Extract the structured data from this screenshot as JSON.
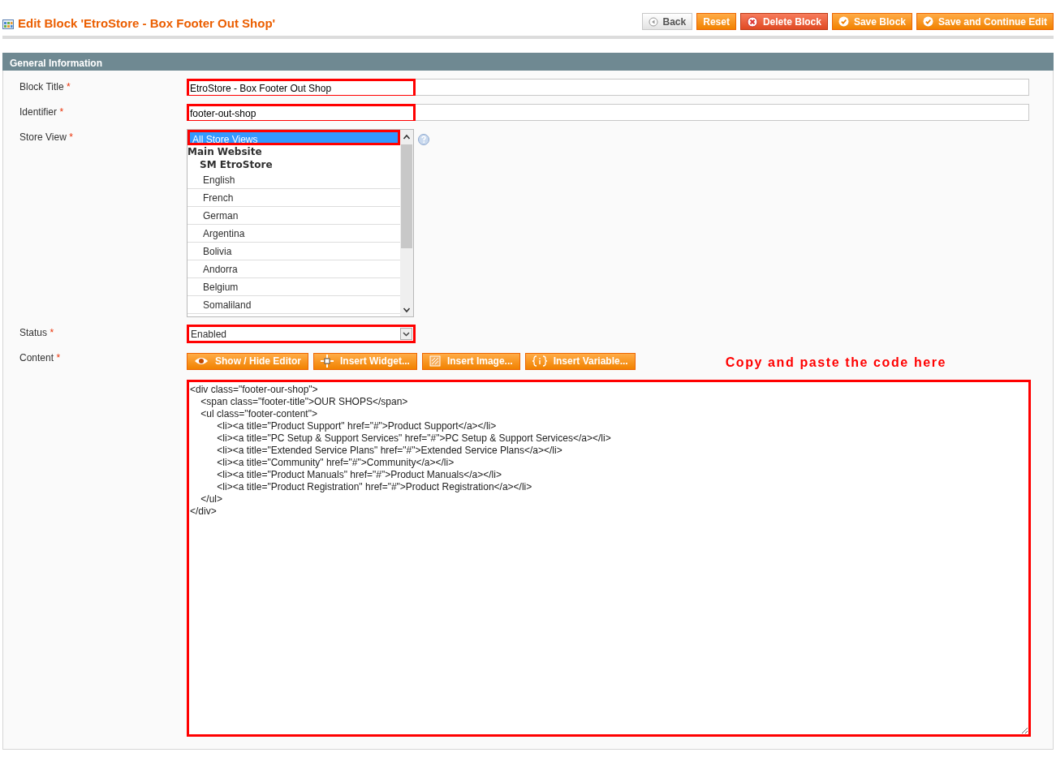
{
  "page": {
    "title": "Edit Block 'EtroStore - Box Footer Out Shop'"
  },
  "actions": [
    {
      "label": "Back",
      "kind": "back"
    },
    {
      "label": "Reset",
      "kind": "reset"
    },
    {
      "label": "Delete Block",
      "kind": "delete"
    },
    {
      "label": "Save Block",
      "kind": "save"
    },
    {
      "label": "Save and Continue Edit",
      "kind": "save"
    }
  ],
  "section": {
    "title": "General Information"
  },
  "fields": [
    {
      "kind": "text",
      "label": "Block Title",
      "required_mark": "*",
      "value": "EtroStore - Box Footer Out Shop",
      "highlighted": true
    },
    {
      "kind": "text",
      "label": "Identifier",
      "required_mark": "*",
      "value": "footer-out-shop",
      "highlighted": true
    },
    {
      "kind": "multiselect",
      "label": "Store View",
      "required_mark": "*",
      "highlighted": true,
      "options": [
        {
          "label": "All Store Views",
          "selected": true
        },
        {
          "label": "Main Website",
          "selected": false,
          "children": [
            {
              "label": "SM EtroStore",
              "selected": false,
              "children": [
                {
                  "label": "English",
                  "selected": false
                },
                {
                  "label": "French",
                  "selected": false
                },
                {
                  "label": "German",
                  "selected": false
                },
                {
                  "label": "Argentina",
                  "selected": false
                },
                {
                  "label": "Bolivia",
                  "selected": false
                },
                {
                  "label": "Andorra",
                  "selected": false
                },
                {
                  "label": "Belgium",
                  "selected": false
                },
                {
                  "label": "Somaliland",
                  "selected": false
                }
              ]
            }
          ]
        }
      ]
    },
    {
      "kind": "select",
      "label": "Status",
      "required_mark": "*",
      "value": "Enabled",
      "highlighted": true
    },
    {
      "kind": "editor",
      "label": "Content",
      "required_mark": "*",
      "highlighted": true,
      "buttons": [
        {
          "label": "Show / Hide Editor",
          "kind": "eye"
        },
        {
          "label": "Insert Widget...",
          "kind": "widget"
        },
        {
          "label": "Insert Image...",
          "kind": "image"
        },
        {
          "label": "Insert Variable...",
          "kind": "variable"
        }
      ],
      "note": "Copy and paste the code here",
      "value": "<div class=\"footer-our-shop\">\n    <span class=\"footer-title\">OUR SHOPS</span>\n    <ul class=\"footer-content\">\n          <li><a title=\"Product Support\" href=\"#\">Product Support</a></li>\n          <li><a title=\"PC Setup & Support Services\" href=\"#\">PC Setup & Support Services</a></li>\n          <li><a title=\"Extended Service Plans\" href=\"#\">Extended Service Plans</a></li>\n          <li><a title=\"Community\" href=\"#\">Community</a></li>\n          <li><a title=\"Product Manuals\" href=\"#\">Product Manuals</a></li>\n          <li><a title=\"Product Registration\" href=\"#\">Product Registration</a></li>\n    </ul>\n</div>"
    }
  ]
}
